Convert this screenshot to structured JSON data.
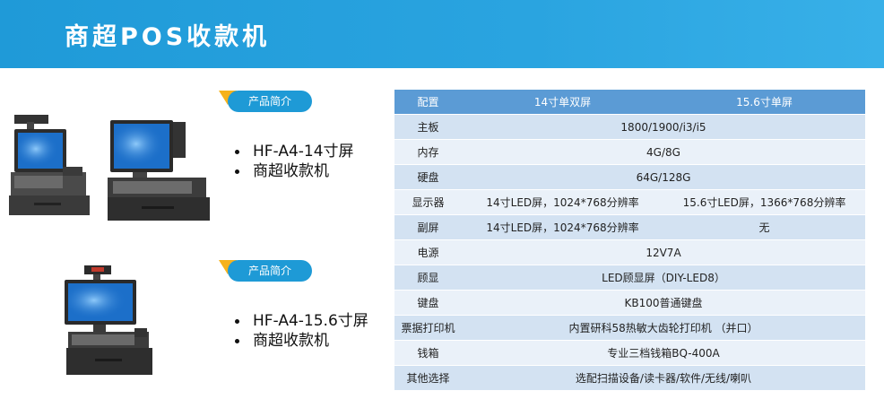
{
  "header": {
    "title": "商超POS收款机"
  },
  "products": [
    {
      "badge": "产品简介",
      "bullets": [
        "HF-A4-14寸屏",
        "商超收款机"
      ]
    },
    {
      "badge": "产品简介",
      "bullets": [
        "HF-A4-15.6寸屏",
        "商超收款机"
      ]
    }
  ],
  "spec_table": {
    "headers": [
      "配置",
      "14寸单双屏",
      "15.6寸单屏"
    ],
    "rows": [
      {
        "label": "主板",
        "merged": "1800/1900/i3/i5"
      },
      {
        "label": "内存",
        "merged": "4G/8G"
      },
      {
        "label": "硬盘",
        "merged": "64G/128G"
      },
      {
        "label": "显示器",
        "a": "14寸LED屏，1024*768分辨率",
        "b": "15.6寸LED屏，1366*768分辨率"
      },
      {
        "label": "副屏",
        "a": "14寸LED屏，1024*768分辨率",
        "b": "无"
      },
      {
        "label": "电源",
        "merged": "12V7A"
      },
      {
        "label": "顾显",
        "merged": "LED顾显屏（DIY-LED8）"
      },
      {
        "label": "键盘",
        "merged": "KB100普通键盘"
      },
      {
        "label": "票据打印机",
        "merged": "内置研科58热敏大齿轮打印机 （并口）"
      },
      {
        "label": "钱箱",
        "merged": "专业三档钱箱BQ-400A"
      },
      {
        "label": "其他选择",
        "merged": "选配扫描设备/读卡器/软件/无线/喇叭"
      }
    ]
  },
  "colors": {
    "header_blue": "#1f9ad8",
    "badge_blue": "#1e9ad6",
    "badge_orange": "#f6b21b",
    "table_header": "#5b9bd5"
  }
}
